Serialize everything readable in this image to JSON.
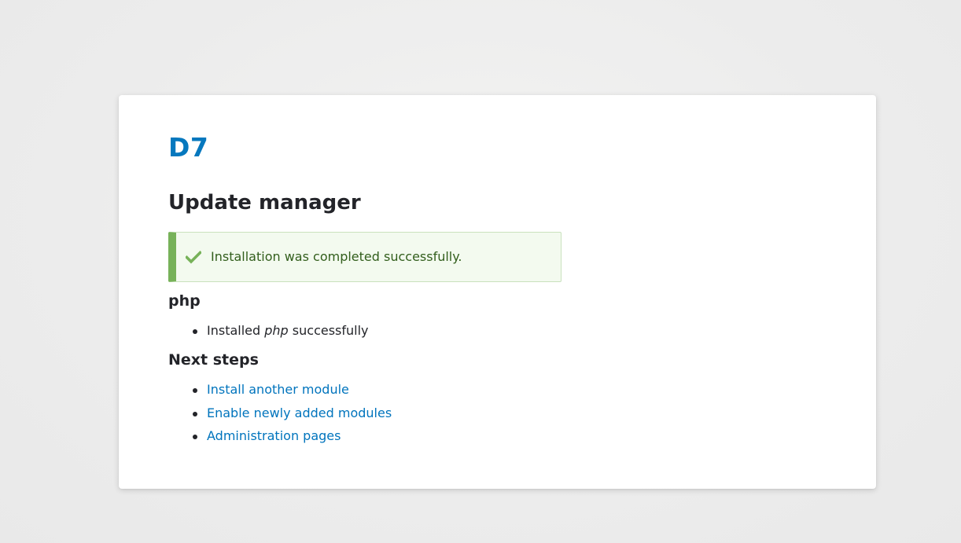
{
  "site": {
    "name": "D7"
  },
  "page": {
    "title": "Update manager"
  },
  "message": {
    "icon": "check-icon",
    "text": "Installation was completed successfully.",
    "colors": {
      "background": "#f3faef",
      "border": "#77b259",
      "text": "#325e1c"
    }
  },
  "php_section": {
    "title": "php",
    "items": [
      {
        "prefix": "Installed ",
        "emphasis": "php",
        "suffix": " successfully"
      }
    ]
  },
  "next_steps": {
    "title": "Next steps",
    "links": [
      {
        "label": "Install another module"
      },
      {
        "label": "Enable newly added modules"
      },
      {
        "label": "Administration pages"
      }
    ]
  },
  "colors": {
    "link": "#0074bd",
    "site_name": "#0678be",
    "text": "#232429"
  }
}
